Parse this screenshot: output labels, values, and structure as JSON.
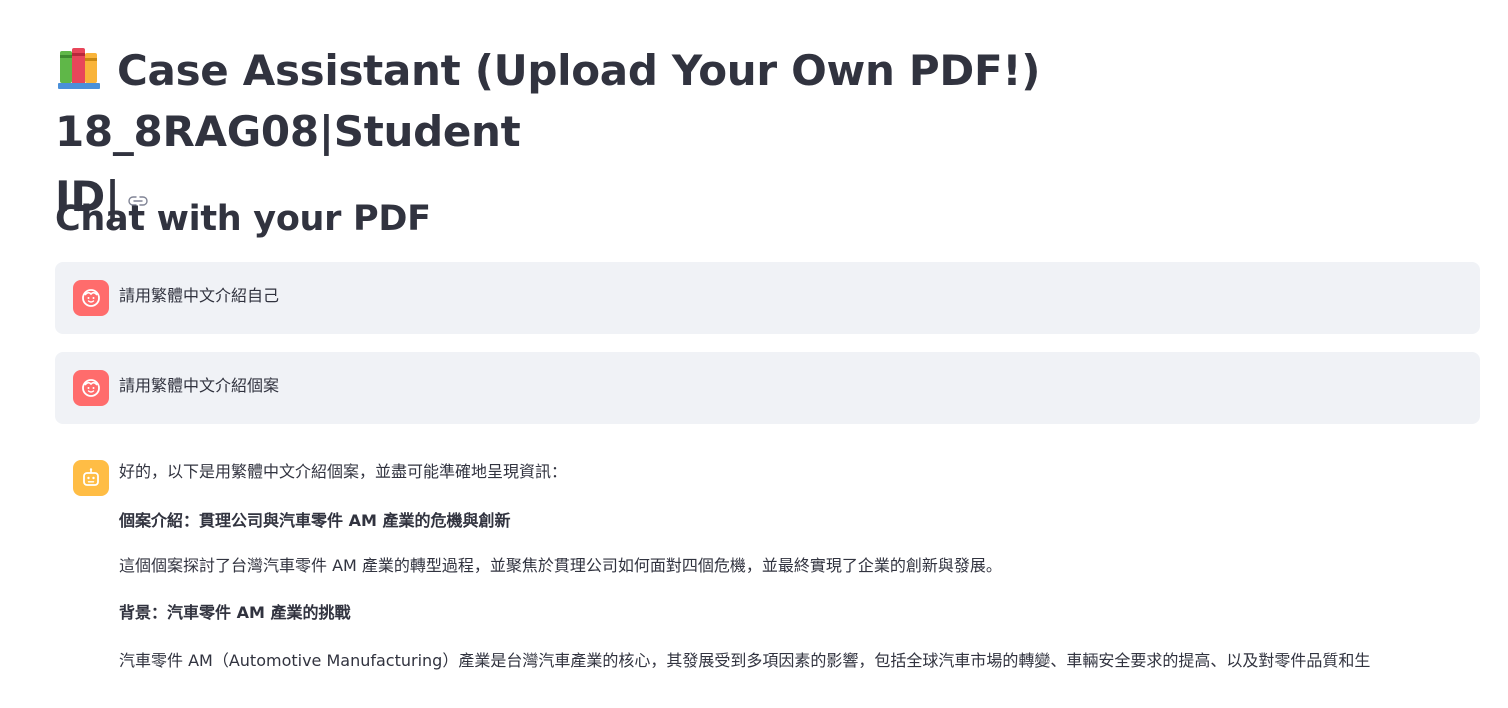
{
  "header": {
    "title_line1": "Case Assistant (Upload Your Own PDF!) 18_8RAG08|Student",
    "title_line2": "ID|",
    "title_icon": "books-icon",
    "anchor_icon": "link-icon"
  },
  "chat": {
    "subheader": "Chat with your PDF",
    "messages": [
      {
        "role": "user",
        "text": "請用繁體中文介紹自己"
      },
      {
        "role": "user",
        "text": "請用繁體中文介紹個案"
      },
      {
        "role": "assistant",
        "intro": "好的，以下是用繁體中文介紹個案，並盡可能準確地呈現資訊：",
        "heading1": "個案介紹：貫理公司與汽車零件 AM 產業的危機與創新",
        "para1": "這個個案探討了台灣汽車零件 AM 產業的轉型過程，並聚焦於貫理公司如何面對四個危機，並最終實現了企業的創新與發展。",
        "heading2": "背景：汽車零件 AM 產業的挑戰",
        "para2": "汽車零件 AM（Automotive Manufacturing）產業是台灣汽車產業的核心，其發展受到多項因素的影響，包括全球汽車市場的轉變、車輛安全要求的提高、以及對零件品質和生"
      }
    ]
  },
  "colors": {
    "user_avatar": "#ff6c6c",
    "assistant_avatar": "#ffbd45",
    "user_bubble": "#f0f2f6",
    "text": "#31333f"
  }
}
